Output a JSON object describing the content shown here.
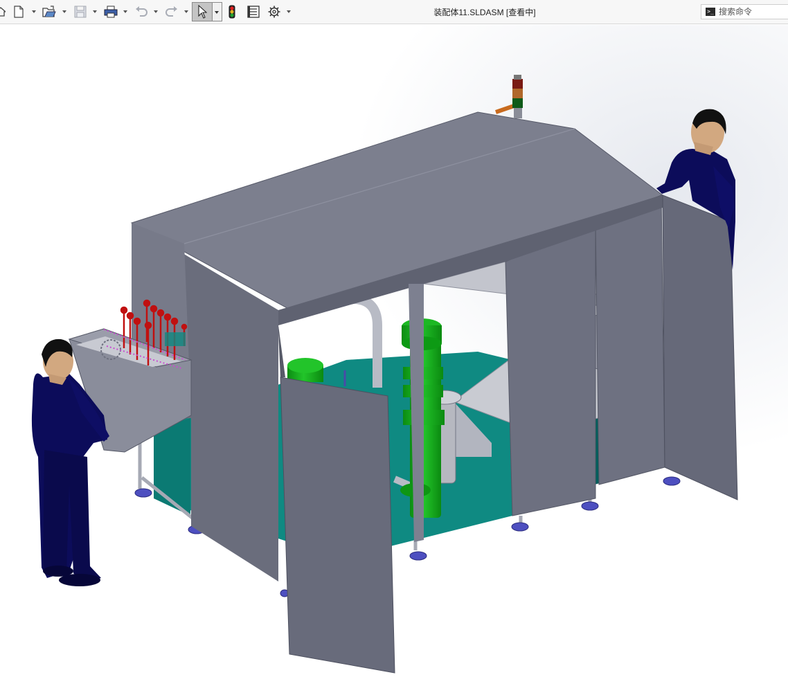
{
  "window": {
    "title": "装配体11.SLDASM [查看中]"
  },
  "toolbar": {
    "items": [
      "home-icon",
      "new-document-icon",
      "open-folder-icon",
      "save-icon",
      "print-icon",
      "undo-icon",
      "redo-icon",
      "select-arrow-icon",
      "rebuild-traffic-light-icon",
      "file-properties-icon",
      "options-gear-icon"
    ]
  },
  "search": {
    "placeholder": "搜索命令"
  },
  "heads_up_toolbar": {
    "items": [
      "zoom-to-fit-icon",
      "zoom-to-area-icon",
      "previous-view-icon",
      "section-view-icon",
      "view-orientation-icon",
      "display-style-icon",
      "hide-show-items-icon",
      "edit-appearance-icon",
      "view-settings-icon"
    ]
  },
  "colors": {
    "housing": "#7c7f8e",
    "housing_dark": "#5f6271",
    "teal_base": "#0f8a82",
    "green_part": "#12a618",
    "person_body": "#0c0c5a",
    "red_pins": "#c01010",
    "background": "#ffffff"
  }
}
